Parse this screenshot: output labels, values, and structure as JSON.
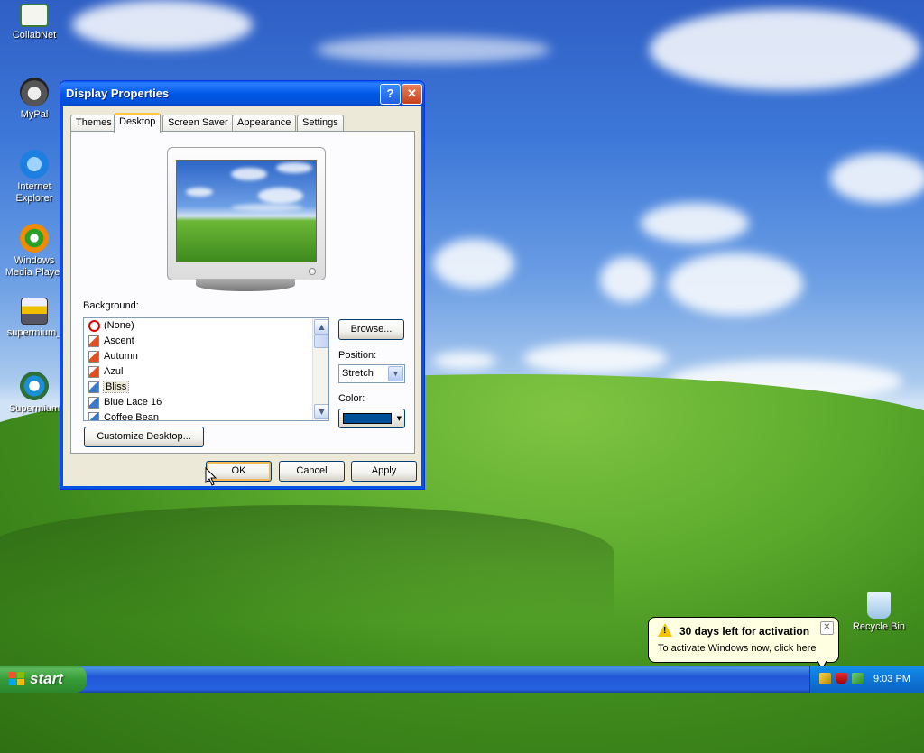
{
  "desktop": {
    "icons": [
      {
        "label": "CollabNet",
        "icon": "collabnet-icon"
      },
      {
        "label": "MyPal",
        "icon": "mypal-icon"
      },
      {
        "label": "Internet Explorer",
        "icon": "internet-explorer-icon"
      },
      {
        "label": "Windows Media Player",
        "icon": "windows-media-player-icon"
      },
      {
        "label": "supermium_",
        "icon": "installer-icon"
      },
      {
        "label": "Supermium",
        "icon": "supermium-icon"
      }
    ],
    "recycle_bin": {
      "label": "Recycle Bin",
      "icon": "recycle-bin-icon"
    }
  },
  "dialog": {
    "title": "Display Properties",
    "help_glyph": "?",
    "close_glyph": "✕",
    "tabs": [
      {
        "label": "Themes",
        "active": false
      },
      {
        "label": "Desktop",
        "active": true
      },
      {
        "label": "Screen Saver",
        "active": false
      },
      {
        "label": "Appearance",
        "active": false
      },
      {
        "label": "Settings",
        "active": false
      }
    ],
    "background_label": "Background:",
    "backgrounds": [
      {
        "label": "(None)",
        "icon": "none-icon",
        "selected": false
      },
      {
        "label": "Ascent",
        "icon": "image-file-icon",
        "selected": false
      },
      {
        "label": "Autumn",
        "icon": "image-file-icon",
        "selected": false
      },
      {
        "label": "Azul",
        "icon": "image-file-icon",
        "selected": false
      },
      {
        "label": "Bliss",
        "icon": "bitmap-file-icon",
        "selected": true
      },
      {
        "label": "Blue Lace 16",
        "icon": "bitmap-file-icon",
        "selected": false
      },
      {
        "label": "Coffee Bean",
        "icon": "bitmap-file-icon",
        "selected": false
      }
    ],
    "browse_label": "Browse...",
    "position_label": "Position:",
    "position_value": "Stretch",
    "color_label": "Color:",
    "color_value": "#004e98",
    "customize_label": "Customize Desktop...",
    "ok_label": "OK",
    "cancel_label": "Cancel",
    "apply_label": "Apply"
  },
  "taskbar": {
    "start_label": "start",
    "clock": "9:03 PM",
    "tray_icons": [
      "activation-key-icon",
      "security-shield-icon",
      "network-icon"
    ]
  },
  "balloon": {
    "title": "30 days left for activation",
    "text": "To activate Windows now, click here"
  },
  "colors": {
    "titlebar_blue": "#0058e6",
    "taskbar_blue": "#2157d7",
    "start_green": "#379d37",
    "dialog_face": "#ece9d8"
  }
}
